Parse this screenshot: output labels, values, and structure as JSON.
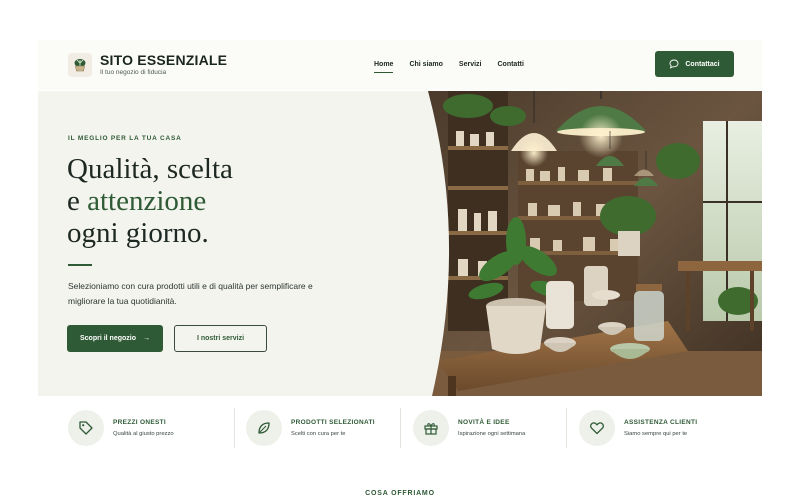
{
  "header": {
    "brand_title": "SITO ESSENZIALE",
    "brand_subtitle": "Il tuo negozio di fiducia",
    "logo_icon": "plant-pot-icon",
    "nav": [
      {
        "label": "Home",
        "active": true
      },
      {
        "label": "Chi siamo",
        "active": false
      },
      {
        "label": "Servizi",
        "active": false
      },
      {
        "label": "Contatti",
        "active": false
      }
    ],
    "contact_button": {
      "label": "Contattaci",
      "icon": "chat-bubble-icon"
    }
  },
  "hero": {
    "eyebrow": "IL MEGLIO PER LA TUA CASA",
    "headline": {
      "line1": "Qualità, scelta",
      "line2_prefix": "e ",
      "line2_accent": "attenzione",
      "line3": "ogni giorno."
    },
    "description": "Selezioniamo con cura prodotti utili e di qualità per semplificare e migliorare la tua quotidianità.",
    "primary_button": {
      "label": "Scopri il negozio",
      "arrow": "→"
    },
    "secondary_button": {
      "label": "I nostri servizi"
    },
    "photo_icon": "shop-interior-photo"
  },
  "features": [
    {
      "title": "PREZZI ONESTI",
      "subtitle": "Qualità al giusto prezzo",
      "icon": "price-tag-icon"
    },
    {
      "title": "PRODOTTI SELEZIONATI",
      "subtitle": "Scelti con cura per te",
      "icon": "leaf-icon"
    },
    {
      "title": "NOVITÀ E IDEE",
      "subtitle": "Ispirazione ogni settimana",
      "icon": "gift-icon"
    },
    {
      "title": "ASSISTENZA CLIENTI",
      "subtitle": "Siamo sempre qui per te",
      "icon": "heart-icon"
    }
  ],
  "section_label": "COSA OFFRIAMO",
  "colors": {
    "accent": "#2e5a35",
    "hero_bg": "#f4f4ef",
    "text": "#1e2822"
  }
}
